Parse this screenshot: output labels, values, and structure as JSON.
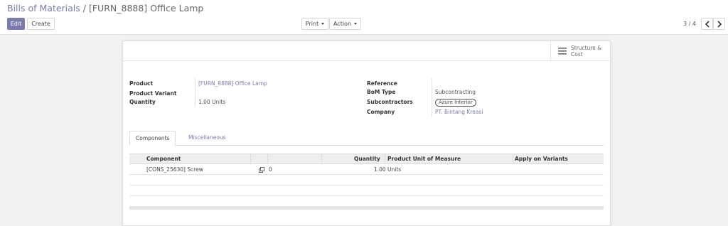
{
  "breadcrumb": {
    "parent": "Bills of Materials",
    "separator": "/",
    "current": "[FURN_8888] Office Lamp"
  },
  "buttons": {
    "edit": "Edit",
    "create": "Create",
    "print": "Print",
    "action": "Action"
  },
  "pager": {
    "value": "3 / 4"
  },
  "stat_button": {
    "label": "Structure & Cost",
    "icon": "list-icon"
  },
  "form": {
    "product_label": "Product",
    "product_value": "[FURN_8888] Office Lamp",
    "variant_label": "Product Variant",
    "quantity_label": "Quantity",
    "quantity_value": "1.00",
    "quantity_uom": "Units",
    "reference_label": "Reference",
    "bom_type_label": "BoM Type",
    "bom_type_value": "Subcontracting",
    "subcontractors_label": "Subcontractors",
    "subcontractors_tag": "Azure Interior",
    "company_label": "Company",
    "company_value": "PT. Bintang Kreasi"
  },
  "tabs": [
    {
      "label": "Components",
      "active": true
    },
    {
      "label": "Miscellaneous",
      "active": false
    }
  ],
  "table": {
    "columns": [
      "Component",
      "Quantity",
      "Product Unit of Measure",
      "Apply on Variants"
    ],
    "rows": [
      {
        "component": "[CONS_25630] Screw",
        "count": "0",
        "quantity": "1.00",
        "uom": "Units",
        "variants": ""
      }
    ]
  },
  "colors": {
    "accent": "#7c7bad",
    "background": "#f2f2f2"
  }
}
